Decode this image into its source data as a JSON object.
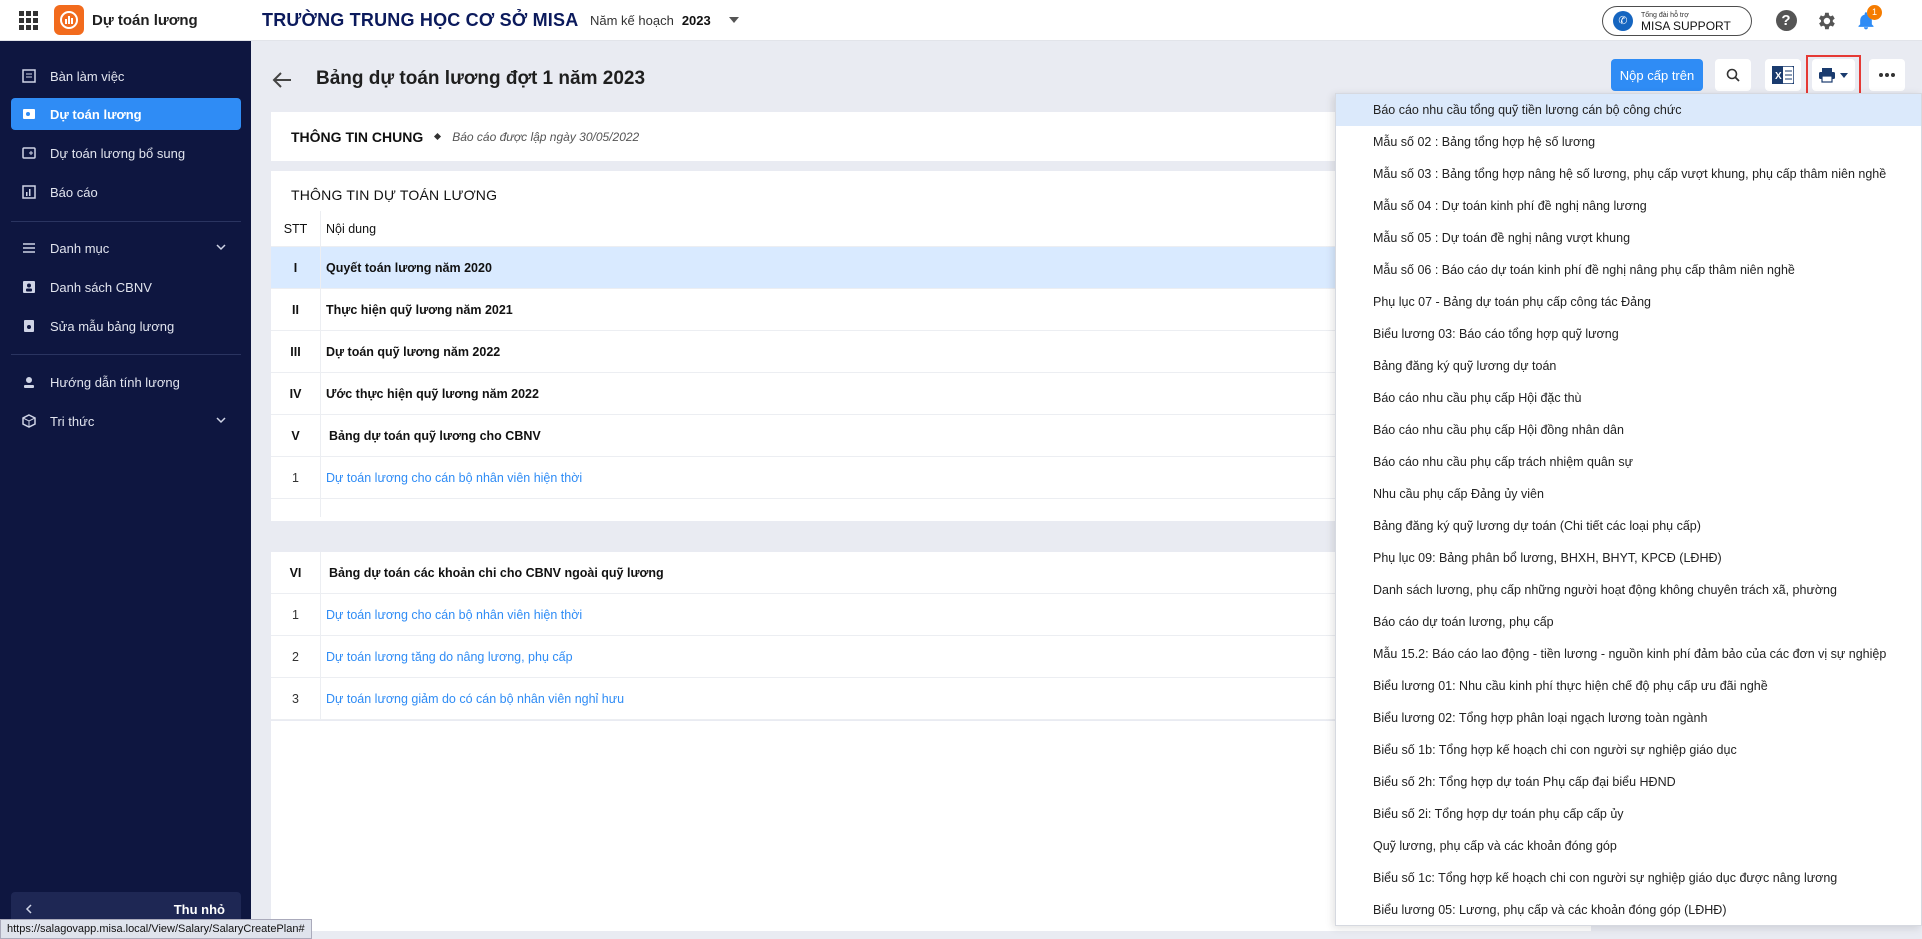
{
  "app": {
    "name": "Dự toán lương",
    "school": "TRƯỜNG TRUNG HỌC CƠ SỞ MISA",
    "plan_year_label": "Năm kế hoạch",
    "plan_year": "2023"
  },
  "header": {
    "support_small": "Tổng đài hỗ trợ",
    "support_big": "MISA SUPPORT",
    "notification_count": "1"
  },
  "sidebar": {
    "items": [
      {
        "label": "Bàn làm việc",
        "icon": "dashboard-icon"
      },
      {
        "label": "Dự toán lương",
        "icon": "salary-estimate-icon"
      },
      {
        "label": "Dự toán lương bổ sung",
        "icon": "salary-supplement-icon"
      },
      {
        "label": "Báo cáo",
        "icon": "report-icon"
      },
      {
        "label": "Danh mục",
        "icon": "list-icon"
      },
      {
        "label": "Danh sách CBNV",
        "icon": "employee-list-icon"
      },
      {
        "label": "Sửa mẫu bảng lương",
        "icon": "edit-template-icon"
      },
      {
        "label": "Hướng dẫn tính lương",
        "icon": "guide-icon"
      },
      {
        "label": "Tri thức",
        "icon": "knowledge-icon"
      }
    ],
    "collapse_label": "Thu nhỏ"
  },
  "status_url": "https://salagovapp.misa.local/View/Salary/SalaryCreatePlan#",
  "page": {
    "title": "Bảng dự toán lương đợt 1 năm 2023",
    "submit_label": "Nộp cấp trên",
    "general_title": "THÔNG TIN CHUNG",
    "general_sub": "Báo cáo được lập ngày 30/05/2022",
    "estimate_title": "THÔNG TIN DỰ TOÁN LƯƠNG",
    "table_headers": {
      "stt": "STT",
      "content": "Nội dung"
    },
    "rows": [
      {
        "stt": "I",
        "content": "Quyết toán lương năm 2020"
      },
      {
        "stt": "II",
        "content": "Thực hiện quỹ lương năm 2021"
      },
      {
        "stt": "III",
        "content": "Dự toán quỹ lương năm 2022"
      },
      {
        "stt": "IV",
        "content": "Ước thực hiện quỹ lương năm 2022"
      },
      {
        "stt": "V",
        "content": "Bảng dự toán quỹ lương cho CBNV"
      },
      {
        "stt": "1",
        "content": "Dự toán lương cho cán bộ nhân viên hiện thời"
      }
    ],
    "rows2": [
      {
        "stt": "VI",
        "content": "Bảng dự toán các khoản chi cho CBNV ngoài quỹ lương"
      },
      {
        "stt": "1",
        "content": "Dự toán lương cho cán bộ nhân viên hiện thời"
      },
      {
        "stt": "2",
        "content": "Dự toán lương tăng do nâng lương, phụ cấp"
      },
      {
        "stt": "3",
        "content": "Dự toán lương giảm do có cán bộ nhân viên nghỉ hưu"
      }
    ]
  },
  "print_menu": [
    "Báo cáo nhu cầu tổng quỹ tiền lương cán bộ công chức",
    "Mẫu số 02 : Bảng tổng hợp hệ số lương",
    "Mẫu số 03 : Bảng tổng hợp nâng hệ số lương, phụ cấp vượt khung, phụ cấp thâm niên nghề",
    "Mẫu số 04 : Dự toán kinh phí đề nghị nâng lương",
    "Mẫu số 05 : Dự toán đề nghị nâng vượt khung",
    "Mẫu số 06 : Báo cáo dự toán kinh phí đề nghị nâng phụ cấp thâm niên nghề",
    "Phụ lục 07 - Bảng dự toán phụ cấp công tác Đảng",
    "Biểu lương 03: Báo cáo tổng hợp quỹ lương",
    "Bảng đăng ký quỹ lương dự toán",
    "Báo cáo nhu cầu phụ cấp Hội đặc thù",
    "Báo cáo nhu cầu phụ cấp Hội đồng nhân dân",
    "Báo cáo nhu cầu phụ cấp trách nhiệm quân sự",
    "Nhu cầu phụ cấp Đảng ủy viên",
    "Bảng đăng ký quỹ lương dự toán (Chi tiết các loại phụ cấp)",
    "Phụ lục 09: Bảng phân bổ lương, BHXH, BHYT, KPCĐ (LĐHĐ)",
    "Danh sách lương, phụ cấp những người hoạt động không chuyên trách xã, phường",
    "Báo cáo dự toán lương, phụ cấp",
    "Mẫu 15.2: Báo cáo lao động - tiền lương - nguồn kinh phí đảm bảo của các đơn vị sự nghiệp",
    "Biểu lương 01: Nhu cầu kinh phí thực hiện chế độ phụ cấp ưu đãi nghề",
    "Biểu lương 02: Tổng hợp phân loại ngạch lương toàn ngành",
    "Biểu số 1b: Tổng hợp kế hoạch chi con người sự nghiệp giáo dục",
    "Biểu số 2h: Tổng hợp dự toán Phụ cấp đại biểu HĐND",
    "Biểu số 2i: Tổng hợp dự toán phụ cấp cấp ủy",
    "Quỹ lương, phụ cấp và các khoản đóng góp",
    "Biểu số 1c: Tổng hợp kế hoạch chi con người sự nghiệp giáo dục được nâng lương",
    "Biểu lương 05: Lương, phụ cấp và các khoản đóng góp (LĐHĐ)"
  ],
  "colors": {
    "accent": "#2f8cf5",
    "sidebar": "#0e1640",
    "logo": "#f26b1d",
    "highlight": "#e53935"
  }
}
